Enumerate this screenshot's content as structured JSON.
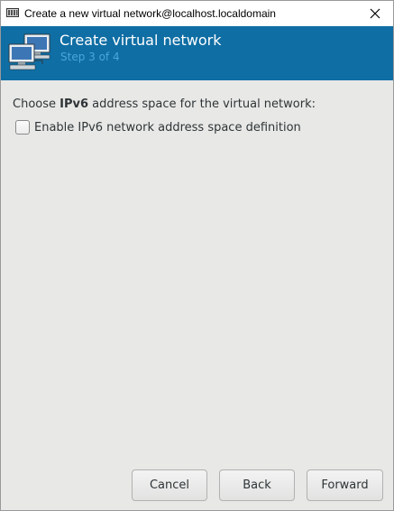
{
  "window": {
    "title": "Create a new virtual network@localhost.localdomain",
    "icons": [
      "app-icon",
      "close-icon"
    ]
  },
  "header": {
    "title": "Create virtual network",
    "step": "Step 3 of 4",
    "icon": "network-computers-icon",
    "background_color": "#0f6ea4"
  },
  "content": {
    "prompt_before": "Choose ",
    "prompt_bold": "IPv6",
    "prompt_after": " address space for the virtual network:",
    "enable_ipv6": {
      "label": "Enable IPv6 network address space definition",
      "checked": false
    }
  },
  "buttons": {
    "cancel": "Cancel",
    "back": "Back",
    "forward": "Forward"
  }
}
